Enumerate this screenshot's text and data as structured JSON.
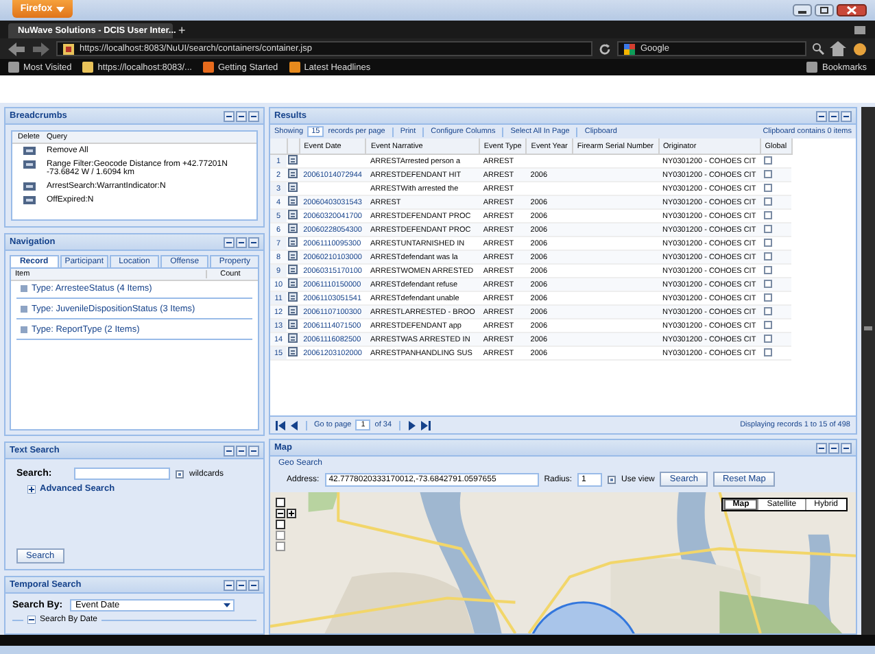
{
  "browser": {
    "menu_button": "Firefox",
    "tab_title": "NuWave Solutions - DCIS User Inter...",
    "new_tab": "+",
    "url": "https://localhost:8083/NuUI/search/containers/container.jsp",
    "search_engine": "Google",
    "bookmarks": [
      "Most Visited",
      "https://localhost:8083/...",
      "Getting Started",
      "Latest Headlines"
    ],
    "bookmarks_menu": "Bookmarks"
  },
  "breadcrumbs": {
    "title": "Breadcrumbs",
    "columns": [
      "Delete",
      "Query"
    ],
    "items": [
      "Remove All",
      "Range Filter:Geocode Distance from +42.77201N -73.6842 W / 1.6094 km",
      "ArrestSearch:WarrantIndicator:N",
      "OffExpired:N"
    ]
  },
  "navigation": {
    "title": "Navigation",
    "tabs": [
      {
        "label": "Record",
        "selected": true
      },
      {
        "label": "Participant",
        "selected": false
      },
      {
        "label": "Location",
        "selected": false
      },
      {
        "label": "Offense",
        "selected": false
      },
      {
        "label": "Property",
        "selected": false
      }
    ],
    "columns": [
      "Item",
      "Count"
    ],
    "items": [
      "Type: ArresteeStatus (4 Items)",
      "Type: JuvenileDispositionStatus (3 Items)",
      "Type: ReportType (2 Items)"
    ]
  },
  "text_search": {
    "title": "Text Search",
    "label": "Search:",
    "wildcard": {
      "label": "wildcards",
      "checked": true
    },
    "advanced": "Advanced Search",
    "button": "Search"
  },
  "temporal_search": {
    "title": "Temporal Search",
    "label": "Search By:",
    "value": "Event Date",
    "fieldset": "Search By Date"
  },
  "results": {
    "title": "Results",
    "toolbar": {
      "showing": "Showing",
      "per_page": "15",
      "per_page_label": "records per page",
      "actions": [
        "Print",
        "Configure Columns",
        "Select All In Page",
        "Clipboard"
      ],
      "clipboard_status": "Clipboard contains 0 items"
    },
    "columns": [
      "Event Date",
      "Event Narrative",
      "Event Type",
      "Event Year",
      "Firearm Serial Number",
      "Originator",
      "Global"
    ],
    "rows": [
      {
        "n": "1",
        "date": "",
        "narrative": "ARRESTArrested person a",
        "type": "ARREST",
        "year": "",
        "originator": "NY0301200 - COHOES CIT",
        "global": false
      },
      {
        "n": "2",
        "date": "20061014072944",
        "narrative": "ARRESTDEFENDANT HIT",
        "type": "ARREST",
        "year": "2006",
        "originator": "NY0301200 - COHOES CIT",
        "global": false
      },
      {
        "n": "3",
        "date": "",
        "narrative": "ARRESTWith arrested the",
        "type": "ARREST",
        "year": "",
        "originator": "NY0301200 - COHOES CIT",
        "global": false
      },
      {
        "n": "4",
        "date": "20060403031543",
        "narrative": "ARREST",
        "type": "ARREST",
        "year": "2006",
        "originator": "NY0301200 - COHOES CIT",
        "global": false
      },
      {
        "n": "5",
        "date": "20060320041700",
        "narrative": "ARRESTDEFENDANT PROC",
        "type": "ARREST",
        "year": "2006",
        "originator": "NY0301200 - COHOES CIT",
        "global": false
      },
      {
        "n": "6",
        "date": "20060228054300",
        "narrative": "ARRESTDEFENDANT PROC",
        "type": "ARREST",
        "year": "2006",
        "originator": "NY0301200 - COHOES CIT",
        "global": false
      },
      {
        "n": "7",
        "date": "20061110095300",
        "narrative": "ARRESTUNTARNISHED IN",
        "type": "ARREST",
        "year": "2006",
        "originator": "NY0301200 - COHOES CIT",
        "global": false
      },
      {
        "n": "8",
        "date": "20060210103000",
        "narrative": "ARRESTdefendant was la",
        "type": "ARREST",
        "year": "2006",
        "originator": "NY0301200 - COHOES CIT",
        "global": false
      },
      {
        "n": "9",
        "date": "20060315170100",
        "narrative": "ARRESTWOMEN ARRESTED",
        "type": "ARREST",
        "year": "2006",
        "originator": "NY0301200 - COHOES CIT",
        "global": false
      },
      {
        "n": "10",
        "date": "20061110150000",
        "narrative": "ARRESTdefendant refuse",
        "type": "ARREST",
        "year": "2006",
        "originator": "NY0301200 - COHOES CIT",
        "global": false
      },
      {
        "n": "11",
        "date": "20061103051541",
        "narrative": "ARRESTdefendant unable",
        "type": "ARREST",
        "year": "2006",
        "originator": "NY0301200 - COHOES CIT",
        "global": false
      },
      {
        "n": "12",
        "date": "20061107100300",
        "narrative": "ARRESTLARRESTED - BROO",
        "type": "ARREST",
        "year": "2006",
        "originator": "NY0301200 - COHOES CIT",
        "global": false
      },
      {
        "n": "13",
        "date": "20061114071500",
        "narrative": "ARRESTDEFENDANT app",
        "type": "ARREST",
        "year": "2006",
        "originator": "NY0301200 - COHOES CIT",
        "global": false
      },
      {
        "n": "14",
        "date": "20061116082500",
        "narrative": "ARRESTWAS ARRESTED IN",
        "type": "ARREST",
        "year": "2006",
        "originator": "NY0301200 - COHOES CIT",
        "global": false
      },
      {
        "n": "15",
        "date": "20061203102000",
        "narrative": "ARRESTPANHANDLING SUS",
        "type": "ARREST",
        "year": "2006",
        "originator": "NY0301200 - COHOES CIT",
        "global": false
      }
    ],
    "pager": {
      "go_to": "Go to page",
      "page": "1",
      "of": "of 34",
      "status": "Displaying records 1 to 15 of 498"
    }
  },
  "map": {
    "title": "Map",
    "section": "Geo Search",
    "address_label": "Address:",
    "address": "42.7778020333170012,-73.6842791.0597655",
    "radius_label": "Radius:",
    "radius": "1",
    "use_view": {
      "label": "Use view",
      "checked": true
    },
    "buttons": [
      "Search",
      "Reset Map"
    ],
    "map_types": [
      {
        "label": "Map",
        "selected": true
      },
      {
        "label": "Satellite",
        "selected": false
      },
      {
        "label": "Hybrid",
        "selected": false
      }
    ]
  }
}
